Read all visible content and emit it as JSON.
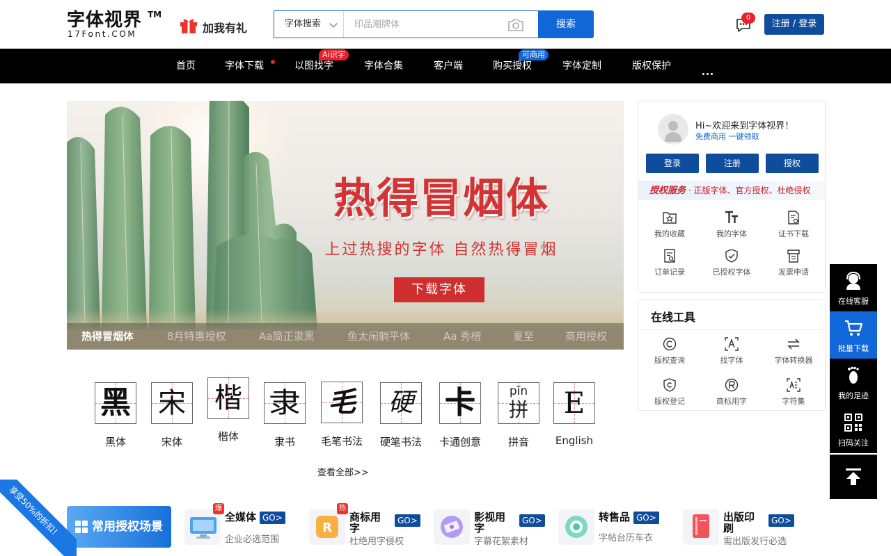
{
  "header": {
    "logo_main": "字体视界",
    "logo_tm": "TM",
    "logo_sub": "17Font.COM",
    "gift_label": "加我有礼",
    "search_type": "字体搜索",
    "search_placeholder": "印品潮牌体",
    "search_button": "搜索",
    "message_count": "0",
    "login_button": "注册 / 登录"
  },
  "nav": {
    "items": [
      {
        "label": "首页"
      },
      {
        "label": "字体下载"
      },
      {
        "label": "以图找字",
        "tag": "Ai识字"
      },
      {
        "label": "字体合集"
      },
      {
        "label": "客户端"
      },
      {
        "label": "购买授权",
        "tag": "可商用"
      },
      {
        "label": "字体定制"
      },
      {
        "label": "版权保护"
      }
    ],
    "tag_colors": {
      "ai": "#e8212c",
      "commercial": "#1267d8"
    }
  },
  "banner": {
    "title": "热得冒烟体",
    "subtitle": "上过热搜的字体 自然热得冒烟",
    "button": "下载字体",
    "tabs": [
      {
        "label": "热得冒烟体",
        "active": true
      },
      {
        "label": "8月特惠授权"
      },
      {
        "label": "Aa简正隶黑"
      },
      {
        "label": "鱼太闲躺平体"
      },
      {
        "label": "Aa 秀楷"
      },
      {
        "label": "夏至"
      },
      {
        "label": "商用授权"
      }
    ]
  },
  "categories": {
    "items": [
      {
        "glyph": "黑",
        "label": "黑体"
      },
      {
        "glyph": "宋",
        "label": "宋体"
      },
      {
        "glyph": "楷",
        "label": "楷体"
      },
      {
        "glyph": "隶",
        "label": "隶书"
      },
      {
        "glyph": "毛",
        "label": "毛笔书法"
      },
      {
        "glyph": "硬",
        "label": "硬笔书法"
      },
      {
        "glyph": "卡",
        "label": "卡通创意"
      },
      {
        "glyph": "拼",
        "pinyin": "pīn",
        "label": "拼音"
      },
      {
        "glyph": "E",
        "label": "English"
      }
    ],
    "see_all": "查看全部>>"
  },
  "user_card": {
    "welcome": "Hi~欢迎来到字体视界！",
    "welcome_sub": "免费商用 一键领取",
    "buttons": [
      "登录",
      "注册",
      "授权"
    ],
    "auth_title": "授权服务",
    "auth_desc": "· 正版字体、官方授权、杜绝侵权",
    "grid": [
      {
        "icon": "star-folder-icon",
        "label": "我的收藏"
      },
      {
        "icon": "font-tt-icon",
        "label": "我的字体"
      },
      {
        "icon": "certificate-icon",
        "label": "证书下载"
      },
      {
        "icon": "order-icon",
        "label": "订单记录"
      },
      {
        "icon": "shield-check-icon",
        "label": "已授权字体"
      },
      {
        "icon": "invoice-icon",
        "label": "发票申请"
      }
    ]
  },
  "tools": {
    "title": "在线工具",
    "items": [
      {
        "icon": "copyright-icon",
        "label": "版权查询"
      },
      {
        "icon": "scan-a-icon",
        "label": "找字体"
      },
      {
        "icon": "convert-icon",
        "label": "字体转换器"
      },
      {
        "icon": "copyright-shield-icon",
        "label": "版权登记"
      },
      {
        "icon": "registered-icon",
        "label": "商标用字"
      },
      {
        "icon": "charset-icon",
        "label": "字符集"
      }
    ]
  },
  "side_bar": {
    "items": [
      {
        "icon": "headset-icon",
        "label": "在线客服"
      },
      {
        "icon": "cart-icon",
        "label": "批量下载"
      },
      {
        "icon": "footprint-icon",
        "label": "我的足迹"
      },
      {
        "icon": "qrcode-icon",
        "label": "扫码关注"
      }
    ]
  },
  "scenarios": {
    "main_label": "常用授权场景",
    "items": [
      {
        "title": "全媒体",
        "go": "GO>",
        "sub": "企业必选范围",
        "hot": "爆"
      },
      {
        "title": "商标用字",
        "go": "GO>",
        "sub": "杜绝用字侵权",
        "hot": "热"
      },
      {
        "title": "影视用字",
        "go": "GO>",
        "sub": "字幕花絮素材"
      },
      {
        "title": "转售品",
        "go": "GO>",
        "sub": "字帖台历车衣"
      },
      {
        "title": "出版印刷",
        "go": "GO>",
        "sub": "需出版发行必选"
      }
    ]
  },
  "ribbon": "享受50%的折扣！"
}
